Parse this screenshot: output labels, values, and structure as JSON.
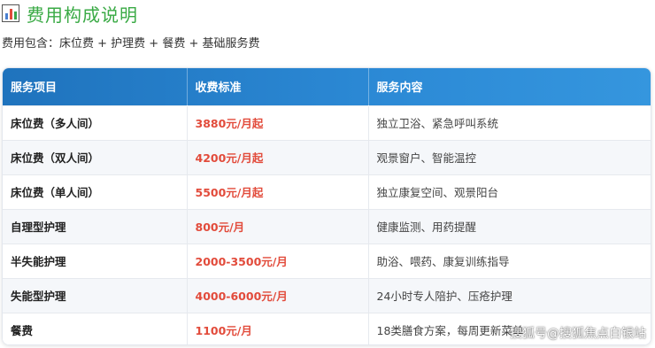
{
  "title": "费用构成说明",
  "subtitle": "费用包含：床位费 + 护理费 + 餐费 + 基础服务费",
  "table": {
    "headers": [
      "服务项目",
      "收费标准",
      "服务内容"
    ],
    "rows": [
      {
        "item": "床位费（多人间）",
        "price": "3880元/月起",
        "content": "独立卫浴、紧急呼叫系统"
      },
      {
        "item": "床位费（双人间）",
        "price": "4200元/月起",
        "content": "观景窗户、智能温控"
      },
      {
        "item": "床位费（单人间）",
        "price": "5500元/月起",
        "content": "独立康复空间、观景阳台"
      },
      {
        "item": "自理型护理",
        "price": "800元/月",
        "content": "健康监测、用药提醒"
      },
      {
        "item": "半失能护理",
        "price": "2000-3500元/月",
        "content": "助浴、喂药、康复训练指导"
      },
      {
        "item": "失能型护理",
        "price": "4000-6000元/月",
        "content": "24小时专人陪护、压疮护理"
      },
      {
        "item": "餐费",
        "price": "1100元/月",
        "content": "18类膳食方案，每周更新菜单"
      }
    ]
  },
  "watermark": "搜狐号@搜狐焦点白银站",
  "colors": {
    "title_green": "#3aaa45",
    "header_blue": "#1f73bd",
    "price_red": "#e24b3b"
  },
  "icons": {
    "title_icon": "bar-chart-icon"
  }
}
